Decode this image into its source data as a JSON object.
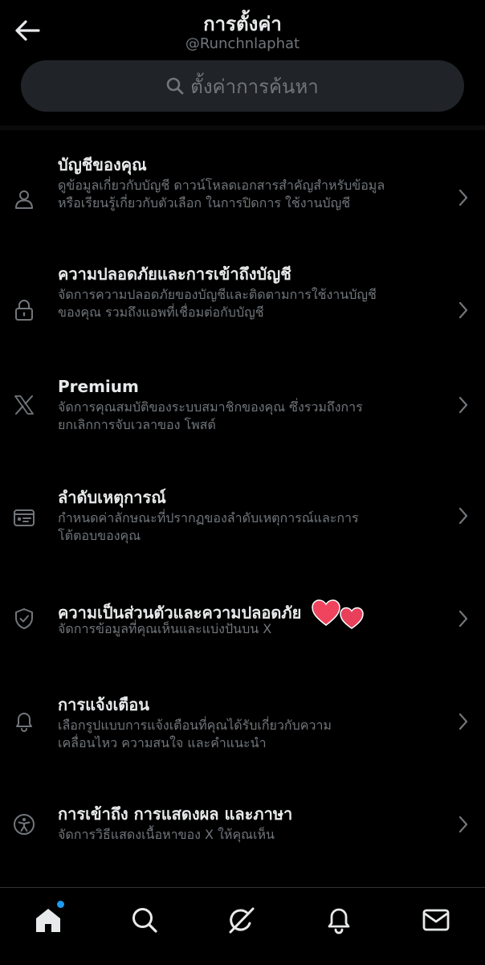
{
  "header": {
    "title": "การตั้งค่า",
    "handle": "@Runchnlaphat",
    "search_placeholder": "ตั้งค่าการค้นหา"
  },
  "settings": [
    {
      "icon": "person-icon",
      "title": "บัญชีของคุณ",
      "desc_line1": "ดูข้อมูลเกี่ยวกับบัญชี ดาวน์โหลดเอกสารสำคัญสำหรับข้อมูล",
      "desc_line2": "หรือเรียนรู้เกี่ยวกับตัวเลือก ในการปิดการ ใช้งานบัญชี"
    },
    {
      "icon": "lock-icon",
      "title": "ความปลอดภัยและการเข้าถึงบัญชี",
      "desc_line1": "จัดการความปลอดภัยของบัญชีและติดตามการใช้งานบัญชี",
      "desc_line2": "ของคุณ รวมถึงแอพที่เชื่อมต่อกับบัญชี"
    },
    {
      "icon": "x-logo-icon",
      "title": "Premium",
      "desc_line1": "จัดการคุณสมบัติของระบบสมาชิกของคุณ ซึ่งรวมถึงการ",
      "desc_line2": "ยกเลิกการจับเวลาของ โพสต์"
    },
    {
      "icon": "timeline-icon",
      "title": "ลำดับเหตุการณ์",
      "desc_line1": "กำหนดค่าลักษณะที่ปรากฏของลำดับเหตุการณ์และการ",
      "desc_line2": "โต้ตอบของคุณ"
    },
    {
      "icon": "shield-check-icon",
      "title": "ความเป็นส่วนตัวและความปลอดภัย",
      "desc_line1": "จัดการข้อมูลที่คุณเห็นและแบ่งปันบน X",
      "desc_line2": ""
    },
    {
      "icon": "bell-icon",
      "title": "การแจ้งเตือน",
      "desc_line1": "เลือกรูปแบบการแจ้งเตือนที่คุณได้รับเกี่ยวกับความ",
      "desc_line2": "เคลื่อนไหว ความสนใจ และคำแนะนำ"
    },
    {
      "icon": "accessibility-icon",
      "title": "การเข้าถึง การแสดงผล และภาษา",
      "desc_line1": "จัดการวิธีแสดงเนื้อหาของ X ให้คุณเห็น",
      "desc_line2": ""
    }
  ],
  "tabbar": [
    "home-icon",
    "search-icon",
    "grok-icon",
    "bell-icon",
    "mail-icon"
  ],
  "colors": {
    "background": "#000000",
    "text": "#e7e9ea",
    "muted": "#71767b",
    "search_bg": "#202327",
    "accent": "#1d9bf0",
    "heart": "#f0445e"
  }
}
